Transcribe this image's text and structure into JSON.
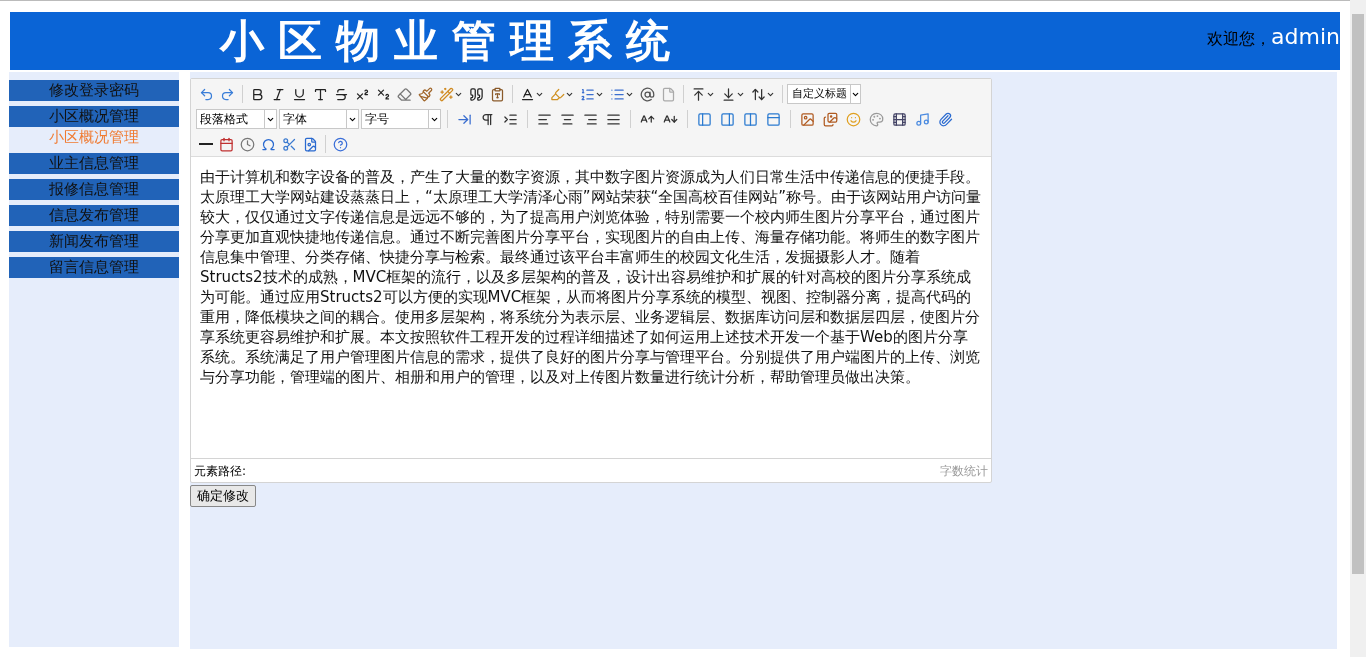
{
  "header": {
    "title": "小区物业管理系统",
    "welcome": "欢迎您，",
    "user": "admin"
  },
  "sidebar": {
    "items": [
      {
        "label": "修改登录密码"
      },
      {
        "label": "小区概况管理",
        "children": [
          {
            "label": "小区概况管理",
            "selected": true
          }
        ]
      },
      {
        "label": "业主信息管理"
      },
      {
        "label": "报修信息管理"
      },
      {
        "label": "信息发布管理"
      },
      {
        "label": "新闻发布管理"
      },
      {
        "label": "留言信息管理"
      }
    ]
  },
  "editor": {
    "heading_select": "自定义标题",
    "selects": [
      "段落格式",
      "字体",
      "字号"
    ],
    "content": "由于计算机和数字设备的普及，产生了大量的数字资源，其中数字图片资源成为人们日常生活中传递信息的便捷手段。太原理工大学网站建设蒸蒸日上，“太原理工大学清泽心雨”网站荣获“全国高校百佳网站”称号。由于该网站用户访问量较大，仅仅通过文字传递信息是远远不够的，为了提高用户浏览体验，特别需要一个校内师生图片分享平台，通过图片分享更加直观快捷地传递信息。通过不断完善图片分享平台，实现图片的自由上传、海量存储功能。将师生的数字图片信息集中管理、分类存储、快捷分享与检索。最终通过该平台丰富师生的校园文化生活，发掘摄影人才。随着Structs2技术的成熟，MVC框架的流行，以及多层架构的普及，设计出容易维护和扩展的针对高校的图片分享系统成为可能。通过应用Structs2可以方便的实现MVC框架，从而将图片分享系统的模型、视图、控制器分离，提高代码的重用，降低模块之间的耦合。使用多层架构，将系统分为表示层、业务逻辑层、数据库访问层和数据层四层，使图片分享系统更容易维护和扩展。本文按照软件工程开发的过程详细描述了如何运用上述技术开发一个基于Web的图片分享系统。系统满足了用户管理图片信息的需求，提供了良好的图片分享与管理平台。分别提供了用户端图片的上传、浏览与分享功能，管理端的图片、相册和用户的管理，以及对上传图片数量进行统计分析，帮助管理员做出决策。",
    "path_label": "元素路径:",
    "word_count": "字数统计"
  },
  "submit": "确定修改"
}
